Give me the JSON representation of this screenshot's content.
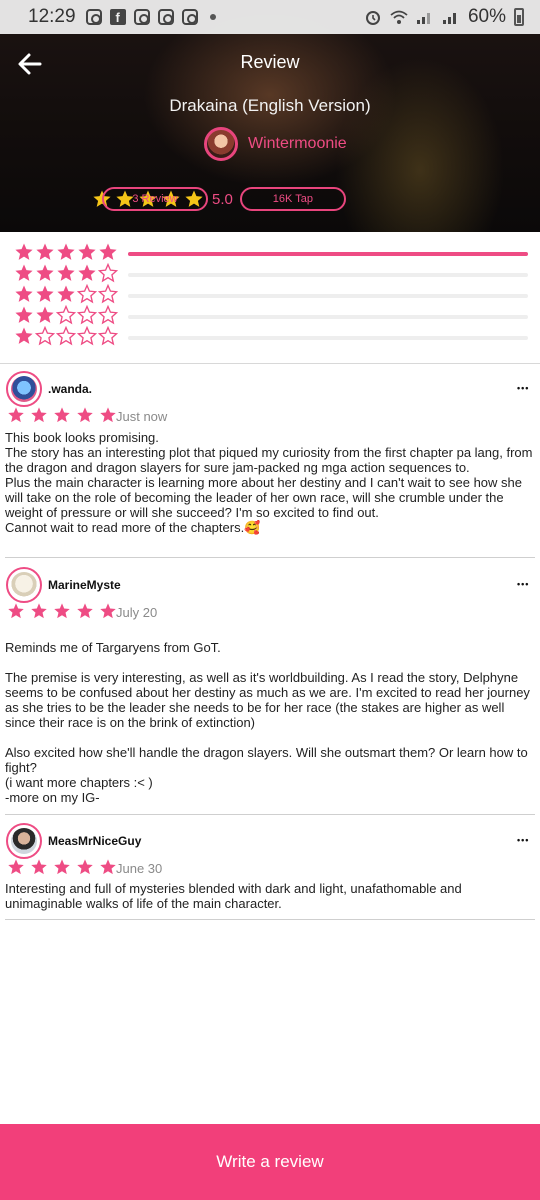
{
  "status_bar": {
    "time": "12:29",
    "battery": "60%"
  },
  "header": {
    "title": "Review",
    "book_title": "Drakaina (English Version)",
    "author": "Wintermoonie",
    "rating": "5.0",
    "stars": 5,
    "review_count_label": "3 Review",
    "tap_count_label": "16K Tap"
  },
  "distribution": [
    {
      "stars": 5,
      "share": 1.0
    },
    {
      "stars": 4,
      "share": 0.0
    },
    {
      "stars": 3,
      "share": 0.0
    },
    {
      "stars": 2,
      "share": 0.0
    },
    {
      "stars": 1,
      "share": 0.0
    }
  ],
  "reviews": [
    {
      "name": ".wanda.",
      "stars": 5,
      "date": "Just now",
      "text": "This book looks promising.\nThe story has an interesting plot that piqued my curiosity from the first chapter pa lang, from the dragon and dragon slayers for sure jam-packed ng mga action sequences to.\nPlus the main character is learning more about her destiny and I can't wait to see how she will take on the role of becoming the leader of her own race, will she crumble under the weight of pressure or will she succeed? I'm so excited to find out.\nCannot wait to read more of the chapters.🥰"
    },
    {
      "name": "MarineMyste",
      "stars": 5,
      "date": "July 20",
      "text": "Reminds me of Targaryens from GoT.\n\nThe premise is very interesting, as well as it's worldbuilding. As I read the story, Delphyne seems to be confused about her destiny as much as we are. I'm excited to read her journey as she tries to be the leader she needs to be for her race (the stakes are higher as well since their race is on the brink of extinction)\n\nAlso excited how she'll handle the dragon slayers. Will she outsmart them? Or learn how to fight?\n(i want more chapters :< )\n-more on my IG-"
    },
    {
      "name": "MeasMrNiceGuy",
      "stars": 5,
      "date": "June 30",
      "text": "Interesting and full of mysteries blended with dark and light, unafathomable and unimaginable walks of life of the main character."
    }
  ],
  "footer": {
    "write_review_label": "Write a review"
  },
  "colors": {
    "accent": "#ee4c84",
    "gold": "#f5c518",
    "button": "#f23f7a"
  },
  "icons": {
    "back": "arrow-left-icon",
    "more": "more-dots-icon",
    "star": "star-icon"
  }
}
